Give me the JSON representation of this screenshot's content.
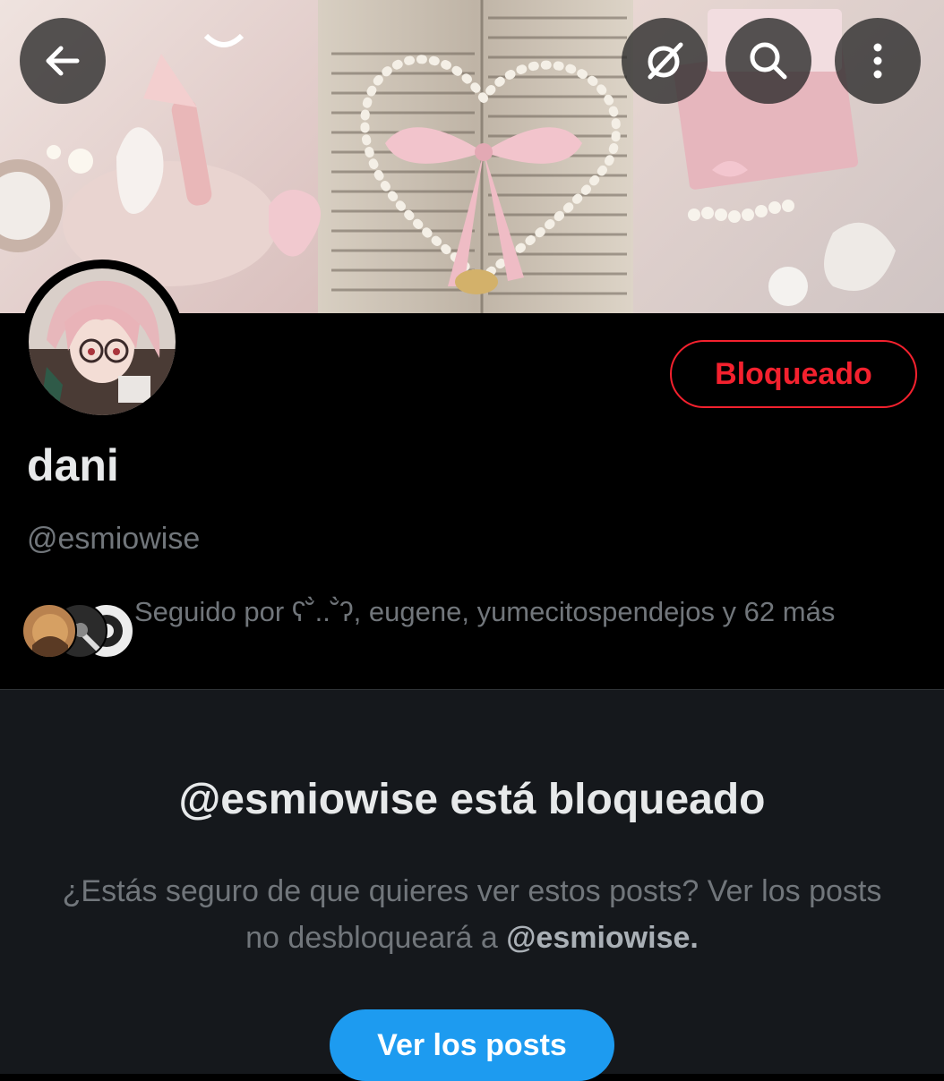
{
  "profile": {
    "display_name": "dani",
    "handle": "@esmiowise",
    "blocked_button_label": "Bloqueado",
    "followed_by_text": "Seguido por ʕ˘̀..˘̀ʔ, eugene, yumecitospendejos y 62 más"
  },
  "header_icons": {
    "back": "back-arrow-icon",
    "grok": "grok-icon",
    "search": "search-icon",
    "more": "more-vertical-icon"
  },
  "blocked_notice": {
    "title": "@esmiowise está bloqueado",
    "description_prefix": "¿Estás seguro de que quieres ver estos posts? Ver los posts no desbloqueará a ",
    "description_handle": "@esmiowise.",
    "view_posts_label": "Ver los posts"
  },
  "colors": {
    "background": "#000000",
    "lower_panel": "#15181c",
    "blocked_red": "#f4212e",
    "accent_blue": "#1d9bf0",
    "muted_text": "#71767b"
  }
}
